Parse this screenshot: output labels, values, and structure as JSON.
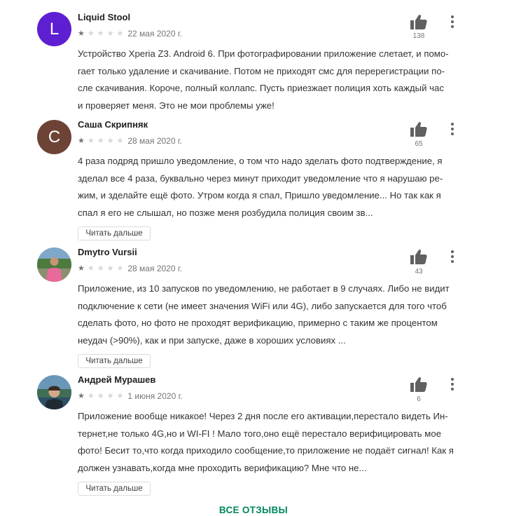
{
  "reviews": [
    {
      "author": "Liquid Stool",
      "avatar_letter": "L",
      "avatar_color": "#5e1ed1",
      "rating": 1,
      "date": "22 мая 2020 г.",
      "likes": "138",
      "lines": [
        "Устройство Xperia Z3. Android 6. При фотографировании приложение слетает, и помо-",
        "гает только удаление и скачивание. Потом не приходят смс для перерегистрации по-",
        "сле скачивания. Короче, полный коллапс. Пусть приезжает полиция хоть каждый час",
        "и проверяет меня. Это не мои проблемы уже!"
      ]
    },
    {
      "author": "Саша Скрипняк",
      "avatar_letter": "С",
      "avatar_color": "#6d4336",
      "rating": 1,
      "date": "28 мая 2020 г.",
      "likes": "65",
      "lines": [
        "4 раза подряд пришло уведомление, о том что надо зделать фото подтверждение, я",
        "зделал все 4 раза, буквально через минут приходит уведомление что я нарушаю ре-",
        "жим, и зделайте ещё фото. Утром когда я спал, Пришло уведомление... Но так как я",
        "спал я его не слышал, но позже меня розбудила полиция своим зв..."
      ],
      "more_label": "Читать дальше"
    },
    {
      "author": "Dmytro Vursii",
      "rating": 1,
      "date": "28 мая 2020 г.",
      "likes": "43",
      "lines": [
        "Приложение, из 10 запусков по уведомлению, не работает в 9 случаях. Либо не видит",
        "подключение к сети (не имеет значения WiFi или 4G), либо запускается для того чтоб",
        "сделать фото, но фото не проходят верификацию, примерно с таким же процентом",
        "неудач (>90%), как и при запуске, даже в хороших условиях ..."
      ],
      "more_label": "Читать дальше"
    },
    {
      "author": "Андрей Мурашев",
      "rating": 1,
      "date": "1 июня 2020 г.",
      "likes": "6",
      "lines": [
        "Приложение вообще никакое! Через 2 дня после его активации,перестало видеть Ин-",
        "тернет,не только 4G,но и WI-FI ! Мало того,оно ещё перестало верифицировать мое",
        "фото! Бесит то,что когда приходило сообщение,то приложение не подаёт сигнал! Как я",
        "должен узнавать,когда мне проходить верификацию? Мне что не..."
      ],
      "more_label": "Читать дальше"
    }
  ],
  "all_reviews_label": "ВСЕ ОТЗЫВЫ",
  "accent_color": "#01875f"
}
